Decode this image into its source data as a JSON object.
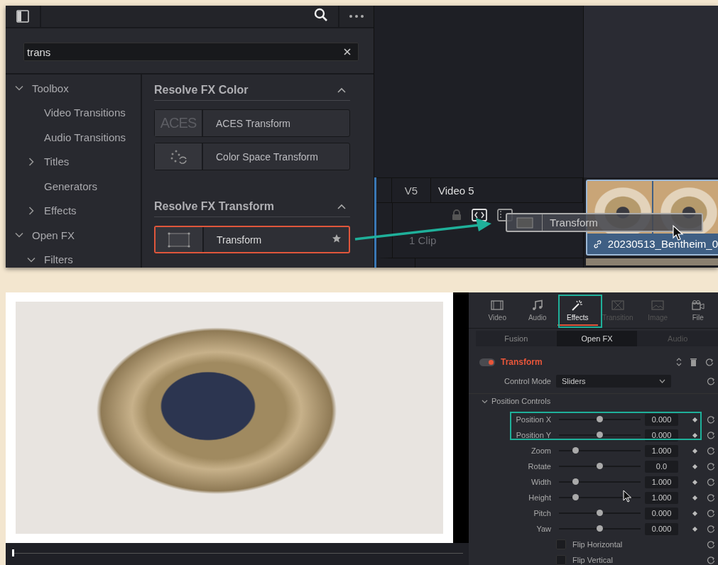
{
  "library": {
    "search": {
      "value": "trans"
    },
    "tree": [
      {
        "label": "Toolbox",
        "expanded": true,
        "children": [
          {
            "label": "Video Transitions"
          },
          {
            "label": "Audio Transitions"
          },
          {
            "label": "Titles",
            "expanded": false
          },
          {
            "label": "Generators"
          },
          {
            "label": "Effects",
            "expanded": false
          }
        ]
      },
      {
        "label": "Open FX",
        "expanded": true,
        "children": [
          {
            "label": "Filters",
            "expanded": true
          }
        ]
      }
    ],
    "groups": [
      {
        "title": "Resolve FX Color",
        "items": [
          {
            "label": "ACES Transform",
            "kind": "text",
            "thumb_text": "ACES",
            "selected": false,
            "favorite": false
          },
          {
            "label": "Color Space Transform",
            "kind": "colorspace",
            "selected": false,
            "favorite": false
          }
        ]
      },
      {
        "title": "Resolve FX Transform",
        "items": [
          {
            "label": "Transform",
            "kind": "frame",
            "selected": true,
            "favorite": true
          }
        ]
      }
    ]
  },
  "timeline": {
    "tracks": [
      {
        "label": "V5",
        "name": "Video 5",
        "clip_count": "1 Clip"
      }
    ],
    "clip": {
      "name": "20230513_Bentheim_0"
    },
    "drag_preview": {
      "label": "Transform"
    }
  },
  "inspector": {
    "tabs": [
      {
        "label": "Video",
        "selected": false,
        "disabled": false
      },
      {
        "label": "Audio",
        "selected": false,
        "disabled": false
      },
      {
        "label": "Effects",
        "selected": true,
        "disabled": false
      },
      {
        "label": "Transition",
        "selected": false,
        "disabled": true
      },
      {
        "label": "Image",
        "selected": false,
        "disabled": true
      },
      {
        "label": "File",
        "selected": false,
        "disabled": false
      }
    ],
    "subtabs": [
      {
        "label": "Fusion",
        "selected": false,
        "disabled": false
      },
      {
        "label": "Open FX",
        "selected": true,
        "disabled": false
      },
      {
        "label": "Audio",
        "selected": false,
        "disabled": true
      }
    ],
    "effect": {
      "title": "Transform",
      "enabled": true
    },
    "control_mode": {
      "label": "Control Mode",
      "value": "Sliders"
    },
    "section": {
      "title": "Position Controls",
      "expanded": true
    },
    "params": [
      {
        "label": "Position X",
        "level": 0.5,
        "value": "0.000"
      },
      {
        "label": "Position Y",
        "level": 0.5,
        "value": "0.000"
      },
      {
        "label": "Zoom",
        "level": 0.2,
        "value": "1.000"
      },
      {
        "label": "Rotate",
        "level": 0.5,
        "value": "0.0"
      },
      {
        "label": "Width",
        "level": 0.2,
        "value": "1.000"
      },
      {
        "label": "Height",
        "level": 0.2,
        "value": "1.000"
      },
      {
        "label": "Pitch",
        "level": 0.5,
        "value": "0.000"
      },
      {
        "label": "Yaw",
        "level": 0.5,
        "value": "0.000"
      }
    ],
    "checkboxes": [
      {
        "label": "Flip Horizontal",
        "checked": false
      },
      {
        "label": "Flip Vertical",
        "checked": false
      }
    ]
  }
}
